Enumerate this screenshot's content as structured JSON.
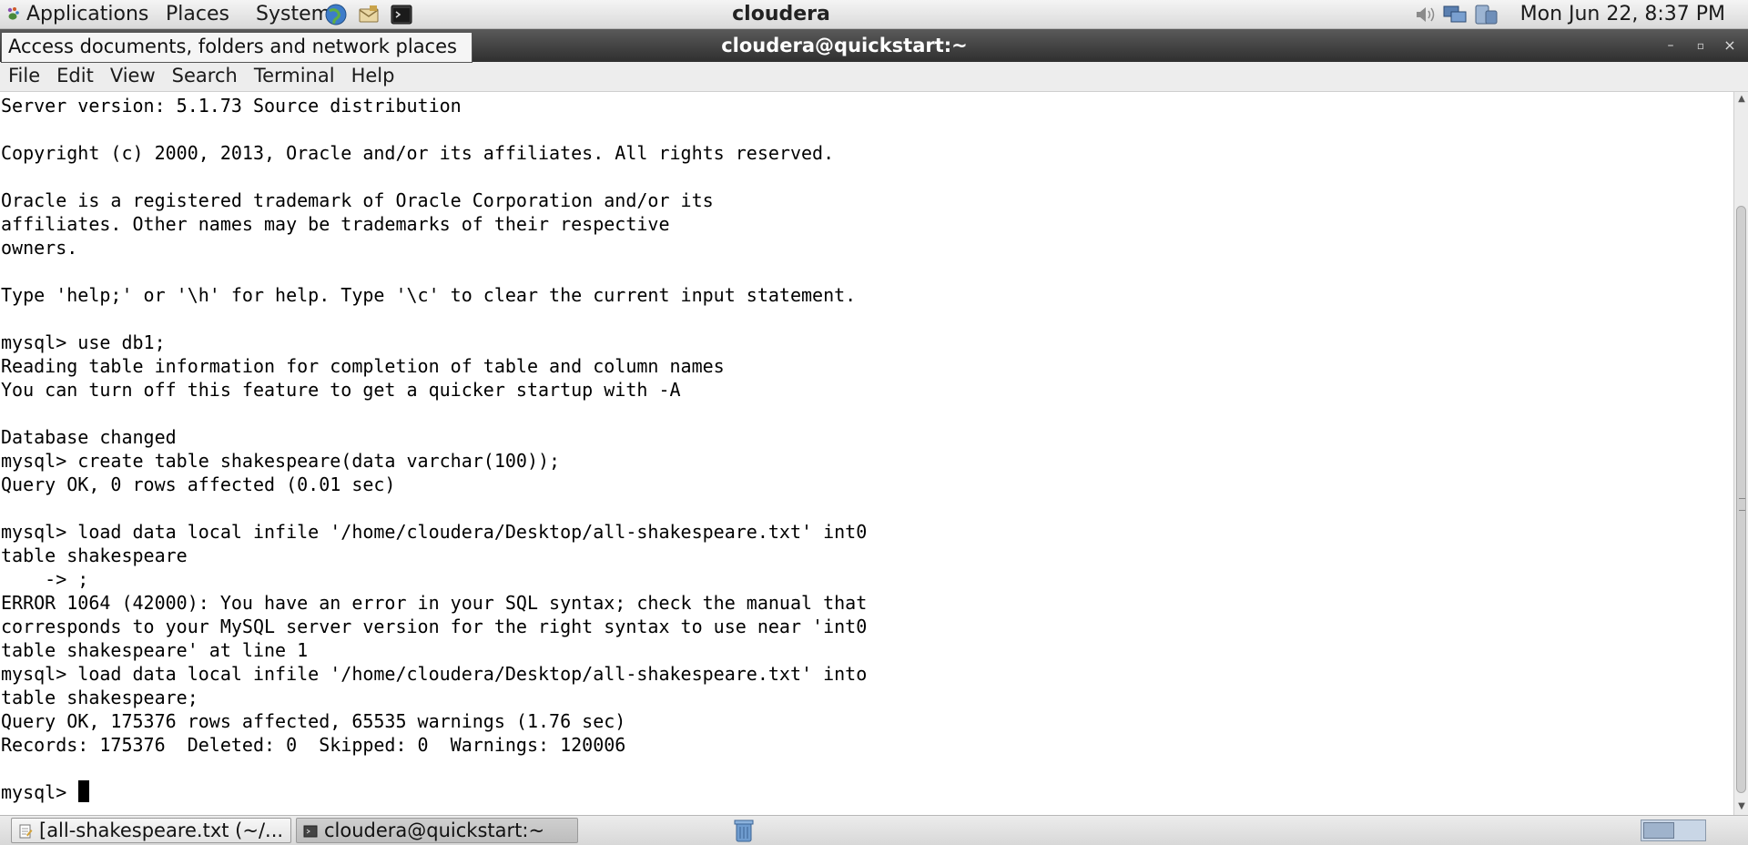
{
  "top_panel": {
    "menus": [
      "Applications",
      "Places",
      "System"
    ],
    "title": "cloudera",
    "clock": "Mon Jun 22,  8:37 PM",
    "launcher_icons": [
      "browser-icon",
      "mail-icon",
      "terminal-icon"
    ],
    "tray_icons": [
      "volume-icon",
      "network-icon",
      "network-manager-icon"
    ]
  },
  "window": {
    "title": "cloudera@quickstart:~",
    "tooltip": "Access documents, folders and network places"
  },
  "menubar": {
    "items": [
      "File",
      "Edit",
      "View",
      "Search",
      "Terminal",
      "Help"
    ]
  },
  "terminal": {
    "lines": [
      "Server version: 5.1.73 Source distribution",
      "",
      "Copyright (c) 2000, 2013, Oracle and/or its affiliates. All rights reserved.",
      "",
      "Oracle is a registered trademark of Oracle Corporation and/or its",
      "affiliates. Other names may be trademarks of their respective",
      "owners.",
      "",
      "Type 'help;' or '\\h' for help. Type '\\c' to clear the current input statement.",
      "",
      "mysql> use db1;",
      "Reading table information for completion of table and column names",
      "You can turn off this feature to get a quicker startup with -A",
      "",
      "Database changed",
      "mysql> create table shakespeare(data varchar(100));",
      "Query OK, 0 rows affected (0.01 sec)",
      "",
      "mysql> load data local infile '/home/cloudera/Desktop/all-shakespeare.txt' int0",
      "table shakespeare",
      "    -> ;",
      "ERROR 1064 (42000): You have an error in your SQL syntax; check the manual that",
      "corresponds to your MySQL server version for the right syntax to use near 'int0",
      "table shakespeare' at line 1",
      "mysql> load data local infile '/home/cloudera/Desktop/all-shakespeare.txt' into",
      "table shakespeare;",
      "Query OK, 175376 rows affected, 65535 warnings (1.76 sec)",
      "Records: 175376  Deleted: 0  Skipped: 0  Warnings: 120006",
      ""
    ],
    "prompt": "mysql> "
  },
  "taskbar": {
    "tasks": [
      "[all-shakespeare.txt (~/...",
      "cloudera@quickstart:~"
    ]
  }
}
